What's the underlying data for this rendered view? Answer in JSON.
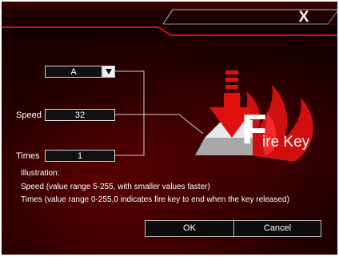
{
  "window": {
    "close_glyph": "X"
  },
  "fire_key": {
    "key": {
      "value": "A"
    },
    "speed": {
      "label": "Speed",
      "value": "32"
    },
    "times": {
      "label": "Times",
      "value": "1"
    }
  },
  "logo": {
    "letter": "F",
    "rest": "ire Key"
  },
  "illustration": {
    "heading": "Illustration:",
    "lines": [
      "Speed (value range 5-255, with smaller values faster)",
      "Times (value range 0-255,0 indicates fire key to end when the key released)"
    ]
  },
  "buttons": {
    "ok": "OK",
    "cancel": "Cancel"
  },
  "colors": {
    "accent_red": "#e01010",
    "background": "#120000"
  }
}
